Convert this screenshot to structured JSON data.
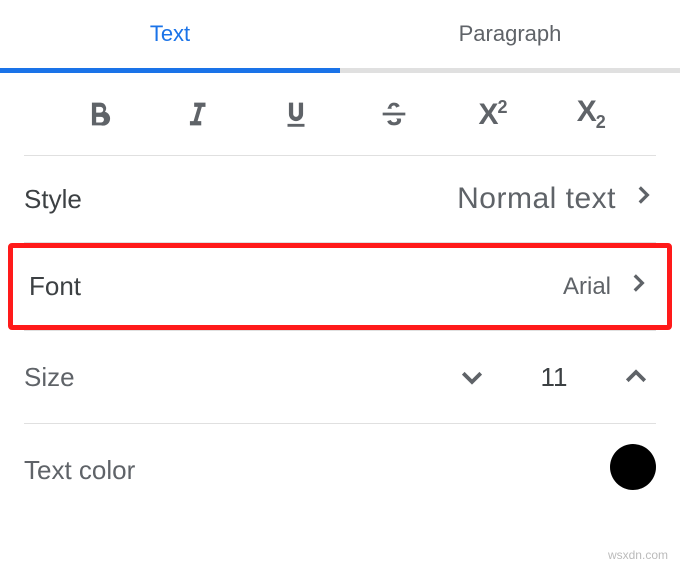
{
  "tabs": {
    "text": "Text",
    "paragraph": "Paragraph"
  },
  "style": {
    "label": "Style",
    "value": "Normal text"
  },
  "font": {
    "label": "Font",
    "value": "Arial"
  },
  "size": {
    "label": "Size",
    "value": "11"
  },
  "textcolor": {
    "label": "Text color",
    "value": "#000000"
  },
  "watermark": "wsxdn.com"
}
